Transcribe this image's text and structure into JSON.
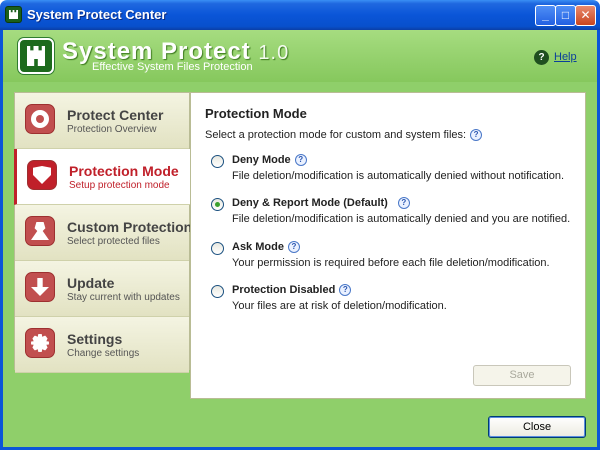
{
  "window": {
    "title": "System Protect Center",
    "min_glyph": "_",
    "max_glyph": "□",
    "close_glyph": "✕"
  },
  "header": {
    "brand_name": "System Protect",
    "brand_version": "1.0",
    "tagline": "Effective System Files Protection",
    "help_icon_glyph": "?",
    "help_label": "Help"
  },
  "sidebar": {
    "items": [
      {
        "title": "Protect Center",
        "subtitle": "Protection Overview",
        "icon": "target-icon",
        "active": false
      },
      {
        "title": "Protection Mode",
        "subtitle": "Setup protection mode",
        "icon": "shield-icon",
        "active": true
      },
      {
        "title": "Custom Protection",
        "subtitle": "Select protected files",
        "icon": "person-icon",
        "active": false
      },
      {
        "title": "Update",
        "subtitle": "Stay current with updates",
        "icon": "download-arrow-icon",
        "active": false
      },
      {
        "title": "Settings",
        "subtitle": "Change settings",
        "icon": "gears-icon",
        "active": false
      }
    ]
  },
  "main": {
    "title": "Protection Mode",
    "description": "Select a protection mode for custom and system files:",
    "info_glyph": "?",
    "options": [
      {
        "title": "Deny Mode",
        "description": "File deletion/modification is automatically denied without notification.",
        "checked": false
      },
      {
        "title": "Deny & Report Mode (Default)",
        "description": "File deletion/modification is automatically denied and you are notified.",
        "checked": true
      },
      {
        "title": "Ask Mode",
        "description": "Your permission is required before each file deletion/modification.",
        "checked": false
      },
      {
        "title": "Protection Disabled",
        "description": "Your files are at risk of deletion/modification.",
        "checked": false
      }
    ],
    "save_label": "Save"
  },
  "footer": {
    "close_label": "Close"
  },
  "colors": {
    "accent_red": "#c0202a",
    "frame_green": "#8fcf6a",
    "titlebar_blue": "#0a55d8"
  }
}
